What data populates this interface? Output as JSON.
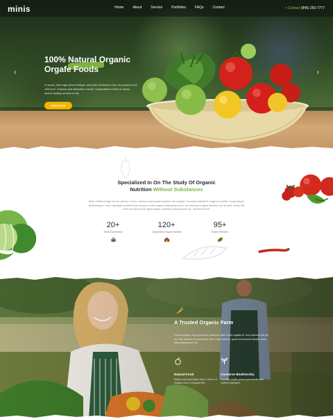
{
  "nav": {
    "logo": "minis",
    "links": [
      "Home",
      "About",
      "Service",
      "Portfolios",
      "FAQs",
      "Contact"
    ],
    "contact_label": "+ Contact",
    "contact_phone": "(845) 250-7777"
  },
  "hero": {
    "title_line1": "100% Natural Organic",
    "title_line2": "Orgafe Foods",
    "description": "In auctor, diam eget varius tristique, ante justo fermentum duo, eu posuere eros velit et mi. Vivamus quis bibendum mauris. Suspendisse et felis ac lectus laoreet facilisis sit amet et elit.",
    "button": "SHOP NOW",
    "prev_icon": "chevron-left-icon",
    "next_icon": "chevron-right-icon",
    "accent": "#7cb342",
    "button_color": "#f4b400"
  },
  "about": {
    "title_line1": "Specialized In On The Study Of Organic",
    "title_line2_a": "Nutrition ",
    "title_line2_b": "Without Substances",
    "description": "Etiam eleifend eget vel leo ultrices. Donec ultrices malesuada tincidunt est suscipit. Curabitur blandit et magna in mattis. Suspendisse pellentesque, risus vulputate condimentum tempus, enim augue malesuada tortor, vel interdum magna faucibus dui sit ante. Nulla nisi amet nisi duis fusce ligula augue, pharetra quis posuere ac, tincidunt at elit.",
    "stats": [
      {
        "num": "20+",
        "label": "Years Experience",
        "icon": "basket-icon"
      },
      {
        "num": "120+",
        "label": "Cooperative Supermarkets",
        "icon": "store-icon"
      },
      {
        "num": "95+",
        "label": "Expert Member",
        "icon": "leaf-icon"
      }
    ]
  },
  "farm": {
    "icon": "carrot-icon",
    "title": "A Trusted Organic Farm",
    "description": "Fusce congue, urna quis luctus euismod, diam lorem sagittis mi, non euismod nisl est nec nisl. Aenean et scelerisque nibh. Etiam ultrices, ipsum id euismod blandit, tortor felis pellentesque elit.",
    "features": [
      {
        "title": "Natural Food",
        "desc": "Nullam sed scelerisque libero. Donec ut tristique dolor, in feugiat felis.",
        "icon": "apple-icon"
      },
      {
        "title": "Conserve Biodiversity",
        "desc": "Curabitur mollis, purus quis lobortis velit eleifend dignissim.",
        "icon": "sprout-icon"
      }
    ]
  }
}
